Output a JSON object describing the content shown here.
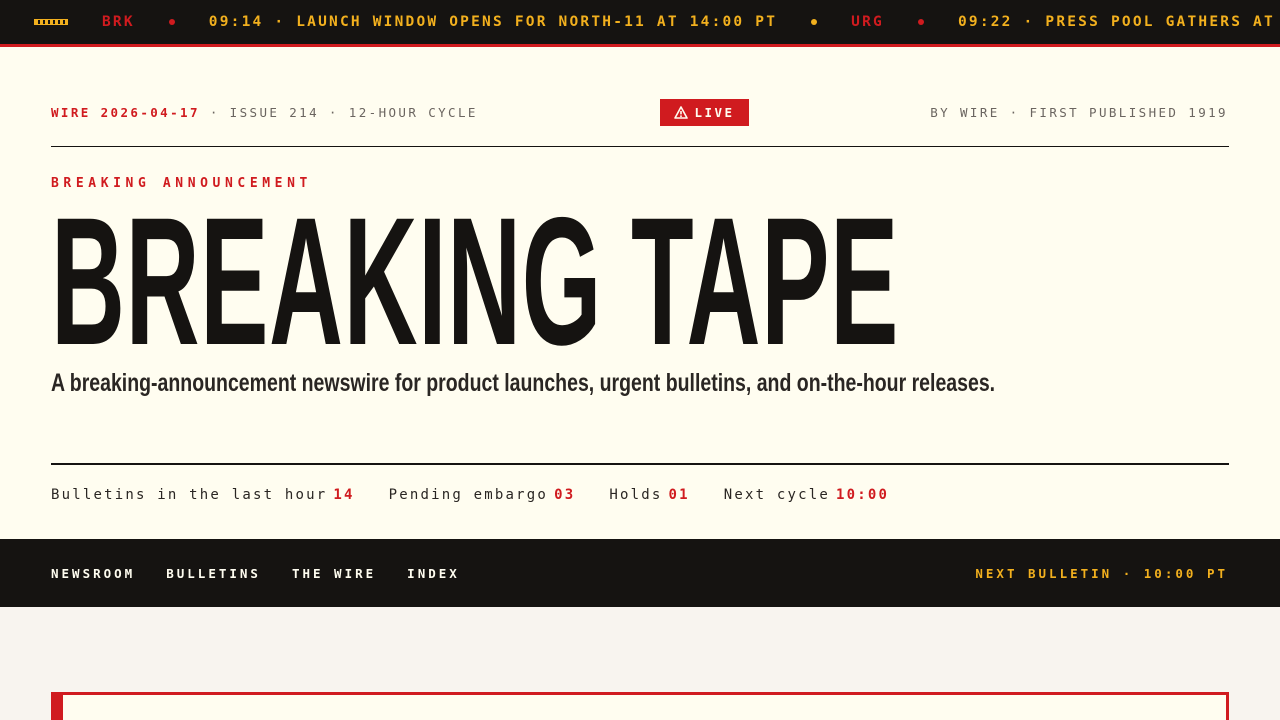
{
  "ticker": {
    "items": [
      {
        "code": "BRK",
        "text": "09:14 · LAUNCH WINDOW OPENS FOR NORTH-11 AT 14:00 PT"
      },
      {
        "code": "URG",
        "text": "09:22 · PRESS POOL GATHERS AT"
      }
    ]
  },
  "masthead": {
    "wire_date": "WIRE 2026-04-17",
    "issue": "· ISSUE 214 · 12-HOUR CYCLE",
    "live_label": "LIVE",
    "byline": "BY WIRE · FIRST PUBLISHED 1919"
  },
  "hero": {
    "kicker": "BREAKING ANNOUNCEMENT",
    "headline": "BREAKING TAPE",
    "dek": "A breaking-announcement newswire for product launches, urgent bulletins, and on-the-hour releases."
  },
  "stats": [
    {
      "label": "Bulletins in the last hour",
      "value": "14"
    },
    {
      "label": "Pending embargo",
      "value": "03"
    },
    {
      "label": "Holds",
      "value": "01"
    },
    {
      "label": "Next cycle",
      "value": "10:00"
    }
  ],
  "nav": {
    "items": [
      "NEWSROOM",
      "BULLETINS",
      "THE WIRE",
      "INDEX"
    ],
    "next_bulletin": "NEXT BULLETIN · 10:00 PT"
  },
  "colors": {
    "accent_red": "#d01b1f",
    "tape_yellow": "#f2b01e",
    "ink": "#151311",
    "paper": "#fffdf0"
  },
  "icons": {
    "tape": "tape-icon",
    "live": "warning-triangle-icon"
  }
}
